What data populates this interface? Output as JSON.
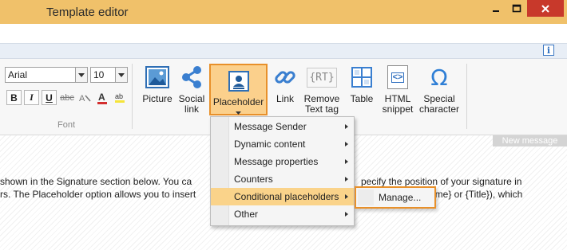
{
  "window": {
    "title": "Template editor"
  },
  "colors": {
    "accent": "#e8902a",
    "highlight": "#fad38a",
    "title_bar": "#f0c16a",
    "close_button": "#c8392b"
  },
  "font_group": {
    "font_name": "Arial",
    "font_size": "10",
    "bold_label": "B",
    "italic_label": "I",
    "underline_label": "U",
    "strike_label": "abc",
    "group_label": "Font"
  },
  "ribbon": {
    "picture": "Picture",
    "social_link_1": "Social",
    "social_link_2": "link",
    "placeholder": "Placeholder",
    "link": "Link",
    "remove_text_tag_1": "Remove",
    "remove_text_tag_2": "Text tag",
    "rt_icon_text": "{RT}",
    "table": "Table",
    "html_snippet_1": "HTML",
    "html_snippet_2": "snippet",
    "html_icon_text": "<>",
    "special_character_1": "Special",
    "special_character_2": "character",
    "special_icon_text": "Ω"
  },
  "info_button": "i",
  "content": {
    "new_message": "New message",
    "line1_a": "shown in the Signature section below. You ca",
    "line1_b": "pecify the position of your signature in",
    "line2_a": "rs. The Placeholder option allows you to insert",
    "line2_b": "ame} or {Title}), which"
  },
  "menu": {
    "items": [
      {
        "label": "Message Sender"
      },
      {
        "label": "Dynamic content"
      },
      {
        "label": "Message properties"
      },
      {
        "label": "Counters"
      },
      {
        "label": "Conditional placeholders"
      },
      {
        "label": "Other"
      }
    ],
    "submenu_label": "Manage..."
  }
}
